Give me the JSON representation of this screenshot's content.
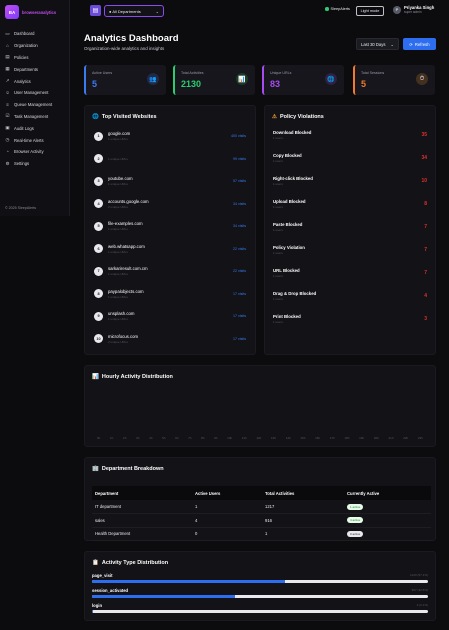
{
  "brand": {
    "initials": "BA",
    "name": "browseranalytics"
  },
  "sidebar": {
    "items": [
      {
        "label": "Dashboard",
        "icon": "▭"
      },
      {
        "label": "Organization",
        "icon": "⌂"
      },
      {
        "label": "Policies",
        "icon": "▤"
      },
      {
        "label": "Departments",
        "icon": "▦"
      },
      {
        "label": "Analytics",
        "icon": "↗"
      },
      {
        "label": "User Management",
        "icon": "☺"
      },
      {
        "label": "Queue Management",
        "icon": "≡"
      },
      {
        "label": "Task Management",
        "icon": "☑"
      },
      {
        "label": "Audit Logs",
        "icon": "▣"
      },
      {
        "label": "Real-time Alerts",
        "icon": "◷"
      },
      {
        "label": "Browser Activity",
        "icon": "◔"
      },
      {
        "label": "Settings",
        "icon": "⚙"
      }
    ],
    "copyright": "© 2025 SleepAlerts"
  },
  "topbar": {
    "menu_icon": "▤",
    "department_select": "All Departments",
    "status_label": "SleepAlerts",
    "light_mode_label": "Light mode",
    "user": {
      "initial": "P",
      "name": "Priyanka Singh",
      "role": "super admin"
    }
  },
  "header": {
    "title": "Analytics Dashboard",
    "subtitle": "Organization-wide analytics and insights",
    "range_select": "Last 30 Days",
    "refresh_label": "Refresh"
  },
  "stats": [
    {
      "label": "Active Users",
      "value": "5",
      "color": "#3b7bf0",
      "icon": "👥"
    },
    {
      "label": "Total Activities",
      "value": "2130",
      "color": "#2ecc71",
      "icon": "📊"
    },
    {
      "label": "Unique URLs",
      "value": "83",
      "color": "#a64cf0",
      "icon": "🌐"
    },
    {
      "label": "Total Sessions",
      "value": "5",
      "color": "#f07a2d",
      "icon": "⏱"
    }
  ],
  "top_sites": {
    "title": "Top Visited Websites",
    "icon": "🌐",
    "items": [
      {
        "rank": "1",
        "name": "google.com",
        "sub": "1 unique URLs",
        "visits": "400 visits"
      },
      {
        "rank": "2",
        "name": "",
        "sub": "1 unique URLs",
        "visits": "99 visits"
      },
      {
        "rank": "3",
        "name": "youtube.com",
        "sub": "1 unique URLs",
        "visits": "57 visits"
      },
      {
        "rank": "4",
        "name": "accounts.google.com",
        "sub": "2 unique URLs",
        "visits": "34 visits"
      },
      {
        "rank": "5",
        "name": "file-examples.com",
        "sub": "1 unique URLs",
        "visits": "34 visits"
      },
      {
        "rank": "6",
        "name": "web.whatsapp.com",
        "sub": "1 unique URLs",
        "visits": "22 visits"
      },
      {
        "rank": "7",
        "name": "sarkariresult.com.cm",
        "sub": "1 unique URLs",
        "visits": "22 visits"
      },
      {
        "rank": "8",
        "name": "paypalobjects.com",
        "sub": "1 unique URLs",
        "visits": "17 visits"
      },
      {
        "rank": "9",
        "name": "unsplash.com",
        "sub": "1 unique URLs",
        "visits": "17 visits"
      },
      {
        "rank": "10",
        "name": "microfocus.com",
        "sub": "2 unique URLs",
        "visits": "17 visits"
      }
    ]
  },
  "violations": {
    "title": "Policy Violations",
    "icon": "⚠",
    "items": [
      {
        "name": "Download Blocked",
        "sub": "1 users",
        "count": "35"
      },
      {
        "name": "Copy Blocked",
        "sub": "1 users",
        "count": "34"
      },
      {
        "name": "Right-click Blocked",
        "sub": "1 users",
        "count": "10"
      },
      {
        "name": "Upload Blocked",
        "sub": "1 users",
        "count": "8"
      },
      {
        "name": "Paste Blocked",
        "sub": "1 users",
        "count": "7"
      },
      {
        "name": "Policy Violation",
        "sub": "1 users",
        "count": "7"
      },
      {
        "name": "URL Blocked",
        "sub": "1 users",
        "count": "7"
      },
      {
        "name": "Drag & Drop Blocked",
        "sub": "1 users",
        "count": "4"
      },
      {
        "name": "Print Blocked",
        "sub": "1 users",
        "count": "3"
      }
    ]
  },
  "hourly": {
    "title": "Hourly Activity Distribution",
    "icon": "📊",
    "hours": [
      "0h",
      "1h",
      "2h",
      "3h",
      "4h",
      "5h",
      "6h",
      "7h",
      "8h",
      "9h",
      "10h",
      "11h",
      "12h",
      "13h",
      "14h",
      "15h",
      "16h",
      "17h",
      "18h",
      "19h",
      "20h",
      "21h",
      "22h",
      "23h"
    ]
  },
  "departments": {
    "title": "Department Breakdown",
    "icon": "🏢",
    "columns": [
      "Department",
      "Active Users",
      "Total Activities",
      "Currently Active"
    ],
    "rows": [
      {
        "name": "IT department",
        "users": "1",
        "activities": "1217",
        "active": "1 active"
      },
      {
        "name": "sales",
        "users": "4",
        "activities": "916",
        "active": "4 active"
      },
      {
        "name": "Health Department",
        "users": "0",
        "activities": "1",
        "active": "0 active"
      }
    ]
  },
  "activity_types": {
    "title": "Activity Type Distribution",
    "icon": "📋",
    "items": [
      {
        "name": "page_visit",
        "count": "1220 (57.3%)",
        "percent": 57.3
      },
      {
        "name": "session_activated",
        "count": "907 (42.6%)",
        "percent": 42.6
      },
      {
        "name": "login",
        "count": "3 (0.1%)",
        "percent": 0.1
      }
    ]
  }
}
